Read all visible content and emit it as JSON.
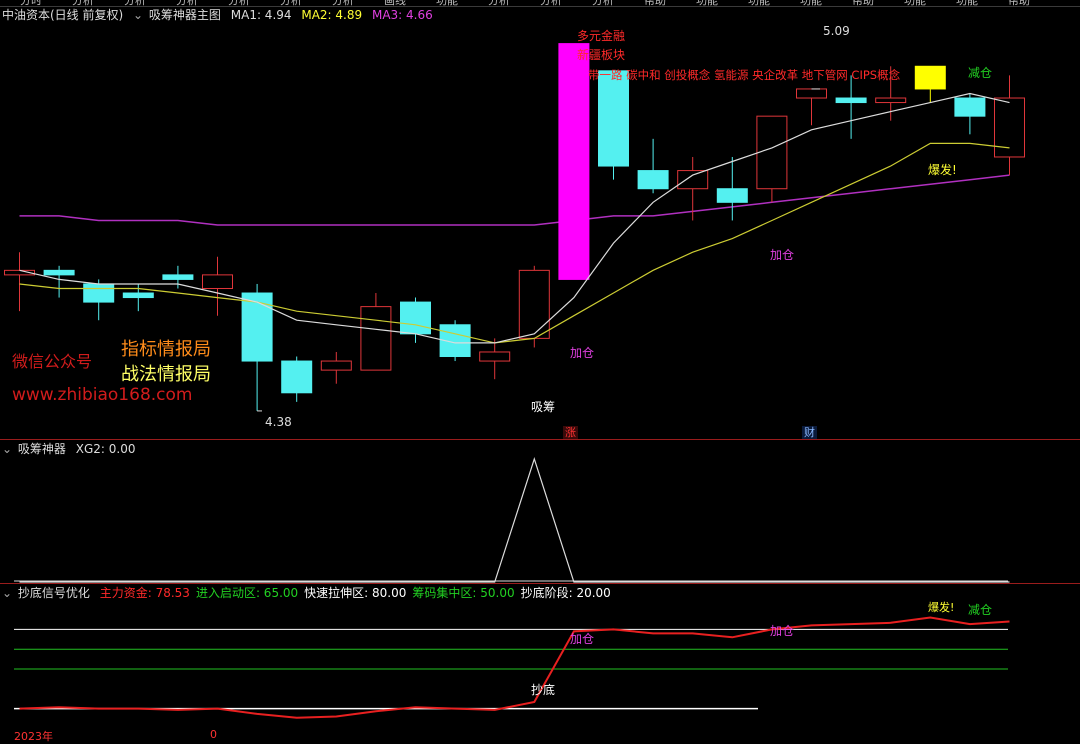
{
  "top_menu": [
    "分时",
    "分析",
    "分析",
    "分析",
    "分析",
    "分析",
    "分析",
    "画线",
    "功能",
    "分析",
    "分析",
    "分析",
    "帮助",
    "功能",
    "功能",
    "功能",
    "帮助",
    "功能",
    "功能",
    "帮助"
  ],
  "main_panel": {
    "stock_name": "中油资本(日线 前复权)",
    "indicator_name": "吸筹神器主图",
    "ma1_label": "MA1: 4.94",
    "ma2_label": "MA2: 4.89",
    "ma3_label": "MA3: 4.66",
    "high_price_label": "5.09",
    "low_price_label": "4.38",
    "concepts": [
      "多元金融",
      "新疆板块",
      "带一路 碳中和 创投概念 氢能源 央企改革 地下管网 CIPS概念"
    ],
    "labels": {
      "jiacang_1": "加仓",
      "jiacang_2": "加仓",
      "xichou": "吸筹",
      "baofa": "爆发!",
      "jiancang": "减仓"
    },
    "badges": {
      "zhang": "涨",
      "cai": "财"
    },
    "watermark": {
      "wechat": "微信公众号",
      "title1": "指标情报局",
      "title2": "战法情报局",
      "url": "www.zhibiao168.com"
    }
  },
  "panel2": {
    "name": "吸筹神器",
    "value_label": "XG2: 0.00"
  },
  "panel3": {
    "name": "抄底信号优化",
    "items": [
      {
        "text": "主力资金: 78.53",
        "color": "#ff2a2a"
      },
      {
        "text": "进入启动区: 65.00",
        "color": "#22d022"
      },
      {
        "text": "快速拉伸区: 80.00",
        "color": "#ffffff"
      },
      {
        "text": "筹码集中区: 50.00",
        "color": "#22d022"
      },
      {
        "text": "抄底阶段: 20.00",
        "color": "#ffffff"
      }
    ],
    "labels": {
      "chaodi": "抄底",
      "jiacang_1": "加仓",
      "jiacang_2": "加仓",
      "baofa": "爆发!",
      "jiancang": "减仓"
    },
    "axis_year": "2023年",
    "axis_month": "0"
  },
  "colors": {
    "up": "#e0363a",
    "down": "#54f0f0",
    "limit_up": "#ff00ff",
    "highlight": "#ffff00",
    "ma1": "#dcdcdc",
    "ma2": "#cccc33",
    "ma3": "#b030c0"
  },
  "chart_data": {
    "type": "candlestick",
    "candles": [
      {
        "o": 4.68,
        "h": 4.73,
        "l": 4.6,
        "c": 4.69
      },
      {
        "o": 4.69,
        "h": 4.7,
        "l": 4.63,
        "c": 4.68
      },
      {
        "o": 4.66,
        "h": 4.67,
        "l": 4.58,
        "c": 4.62
      },
      {
        "o": 4.64,
        "h": 4.66,
        "l": 4.6,
        "c": 4.63
      },
      {
        "o": 4.68,
        "h": 4.7,
        "l": 4.65,
        "c": 4.67
      },
      {
        "o": 4.65,
        "h": 4.72,
        "l": 4.59,
        "c": 4.68
      },
      {
        "o": 4.64,
        "h": 4.66,
        "l": 4.38,
        "c": 4.49
      },
      {
        "o": 4.49,
        "h": 4.5,
        "l": 4.4,
        "c": 4.42
      },
      {
        "o": 4.47,
        "h": 4.51,
        "l": 4.44,
        "c": 4.49
      },
      {
        "o": 4.47,
        "h": 4.64,
        "l": 4.47,
        "c": 4.61
      },
      {
        "o": 4.62,
        "h": 4.63,
        "l": 4.53,
        "c": 4.55
      },
      {
        "o": 4.57,
        "h": 4.58,
        "l": 4.49,
        "c": 4.5
      },
      {
        "o": 4.49,
        "h": 4.54,
        "l": 4.45,
        "c": 4.51
      },
      {
        "o": 4.54,
        "h": 4.7,
        "l": 4.52,
        "c": 4.69
      },
      {
        "o": 4.67,
        "h": 5.19,
        "l": 4.69,
        "c": 5.19
      },
      {
        "o": 5.13,
        "h": 5.13,
        "l": 4.89,
        "c": 4.92
      },
      {
        "o": 4.91,
        "h": 4.98,
        "l": 4.86,
        "c": 4.87
      },
      {
        "o": 4.87,
        "h": 4.94,
        "l": 4.8,
        "c": 4.91
      },
      {
        "o": 4.87,
        "h": 4.94,
        "l": 4.8,
        "c": 4.84
      },
      {
        "o": 4.87,
        "h": 5.02,
        "l": 4.84,
        "c": 5.03
      },
      {
        "o": 5.07,
        "h": 5.09,
        "l": 5.01,
        "c": 5.09
      },
      {
        "o": 5.07,
        "h": 5.12,
        "l": 4.98,
        "c": 5.06
      },
      {
        "o": 5.06,
        "h": 5.14,
        "l": 5.02,
        "c": 5.07
      },
      {
        "o": 5.14,
        "h": 5.13,
        "l": 5.06,
        "c": 5.09
      },
      {
        "o": 5.07,
        "h": 5.08,
        "l": 4.99,
        "c": 5.03
      },
      {
        "o": 4.94,
        "h": 5.12,
        "l": 4.9,
        "c": 5.07
      }
    ],
    "ma1": [
      4.69,
      4.67,
      4.66,
      4.66,
      4.66,
      4.64,
      4.62,
      4.58,
      4.57,
      4.56,
      4.55,
      4.53,
      4.53,
      4.55,
      4.63,
      4.75,
      4.84,
      4.9,
      4.93,
      4.96,
      5.0,
      5.02,
      5.04,
      5.06,
      5.08,
      5.06
    ],
    "ma2": [
      4.66,
      4.65,
      4.65,
      4.65,
      4.64,
      4.63,
      4.62,
      4.6,
      4.59,
      4.58,
      4.57,
      4.55,
      4.53,
      4.54,
      4.59,
      4.64,
      4.69,
      4.73,
      4.76,
      4.8,
      4.84,
      4.88,
      4.92,
      4.97,
      4.97,
      4.96
    ],
    "ma3": [
      4.81,
      4.81,
      4.8,
      4.8,
      4.8,
      4.79,
      4.79,
      4.79,
      4.79,
      4.79,
      4.79,
      4.79,
      4.79,
      4.79,
      4.8,
      4.81,
      4.81,
      4.82,
      4.83,
      4.84,
      4.85,
      4.86,
      4.87,
      4.88,
      4.89,
      4.9
    ],
    "xg2": [
      0,
      0,
      0,
      0,
      0,
      0,
      0,
      0,
      0,
      0,
      0,
      0,
      0,
      1,
      0,
      0,
      0,
      0,
      0,
      0,
      0,
      0,
      0,
      0,
      0,
      0
    ],
    "main_fund": [
      20,
      21,
      20,
      20,
      19,
      20,
      16,
      13,
      14,
      18,
      21,
      20,
      19,
      25,
      78.5,
      80,
      77,
      77,
      74,
      80,
      83,
      84,
      85,
      89,
      84,
      86
    ],
    "levels": {
      "quick_pull": 80.0,
      "start_zone": 65.0,
      "chip_zone": 50.0,
      "bottom": 20.0
    },
    "ylim_price": [
      4.36,
      5.22
    ],
    "ylim_fund": [
      0,
      100
    ]
  }
}
